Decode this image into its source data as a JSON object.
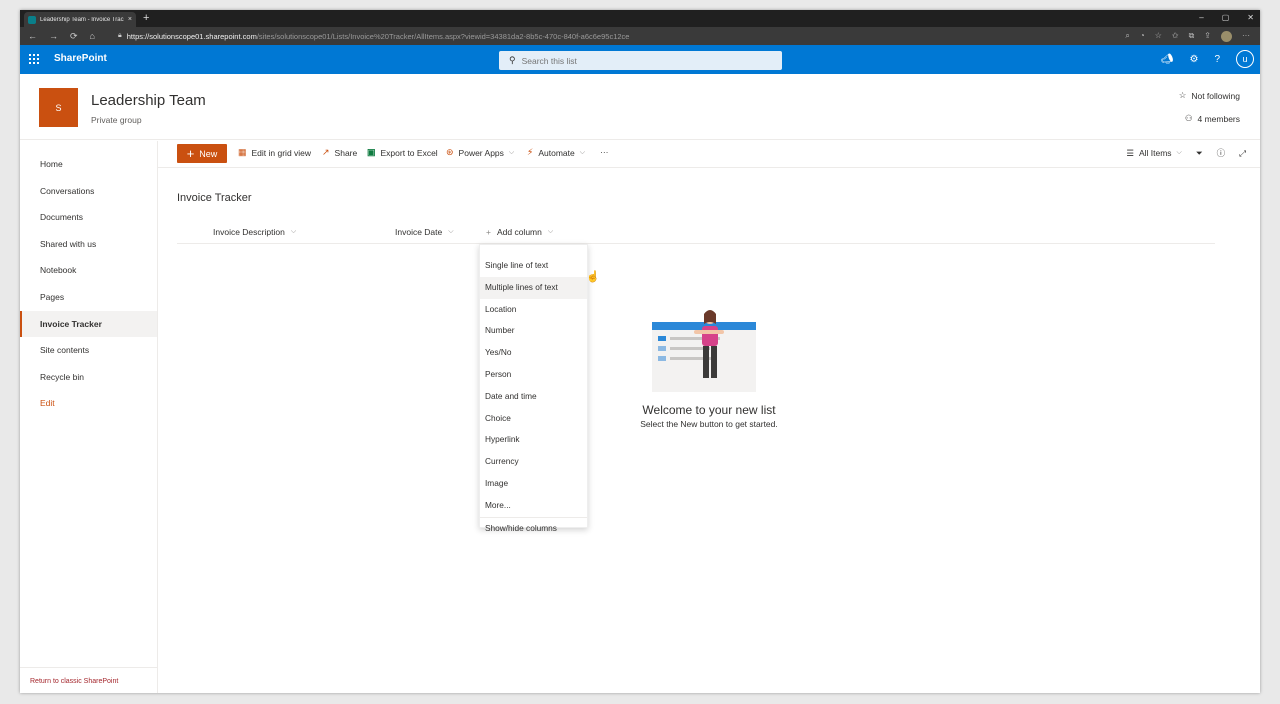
{
  "browser": {
    "tab_title": "Leadership Team - Invoice Tracker",
    "tab_close": "×",
    "new_tab": "+",
    "url_main": "https://solutionscope01.sharepoint.com",
    "url_rest": "/sites/solutionscope01/Lists/Invoice%20Tracker/AllItems.aspx?viewid=34381da2-8b5c-470c-840f-a6c6e95c12ce",
    "nav_back": "←",
    "nav_forward": "→",
    "nav_refresh": "⟳",
    "nav_home": "⌂",
    "win_min": "–",
    "win_max": "▢",
    "win_close": "✕"
  },
  "suite": {
    "brand": "SharePoint",
    "search_placeholder": "Search this list",
    "user_initial": "u"
  },
  "site": {
    "logo_letter": "S",
    "title": "Leadership Team",
    "subtitle": "Private group",
    "follow": "Not following",
    "members": "4 members"
  },
  "leftnav": {
    "items": [
      "Home",
      "Conversations",
      "Documents",
      "Shared with us",
      "Notebook",
      "Pages",
      "Invoice Tracker",
      "Site contents",
      "Recycle bin"
    ],
    "edit": "Edit",
    "classic": "Return to classic SharePoint"
  },
  "commandbar": {
    "new": "New",
    "grid": "Edit in grid view",
    "share": "Share",
    "export": "Export to Excel",
    "powerapps": "Power Apps",
    "automate": "Automate",
    "more": "···",
    "view": "All Items"
  },
  "list": {
    "title": "Invoice Tracker",
    "columns": [
      "Invoice Description",
      "Invoice Date"
    ],
    "add_column": "Add column",
    "add_column_plus": "+"
  },
  "menu": {
    "items": [
      "Single line of text",
      "Multiple lines of text",
      "Location",
      "Number",
      "Yes/No",
      "Person",
      "Date and time",
      "Choice",
      "Hyperlink",
      "Currency",
      "Image",
      "More..."
    ],
    "footer": "Show/hide columns"
  },
  "empty": {
    "title": "Welcome to your new list",
    "subtitle": "Select the New button to get started."
  },
  "colors": {
    "suite_blue": "#0078d4",
    "accent_orange": "#ca5010"
  }
}
